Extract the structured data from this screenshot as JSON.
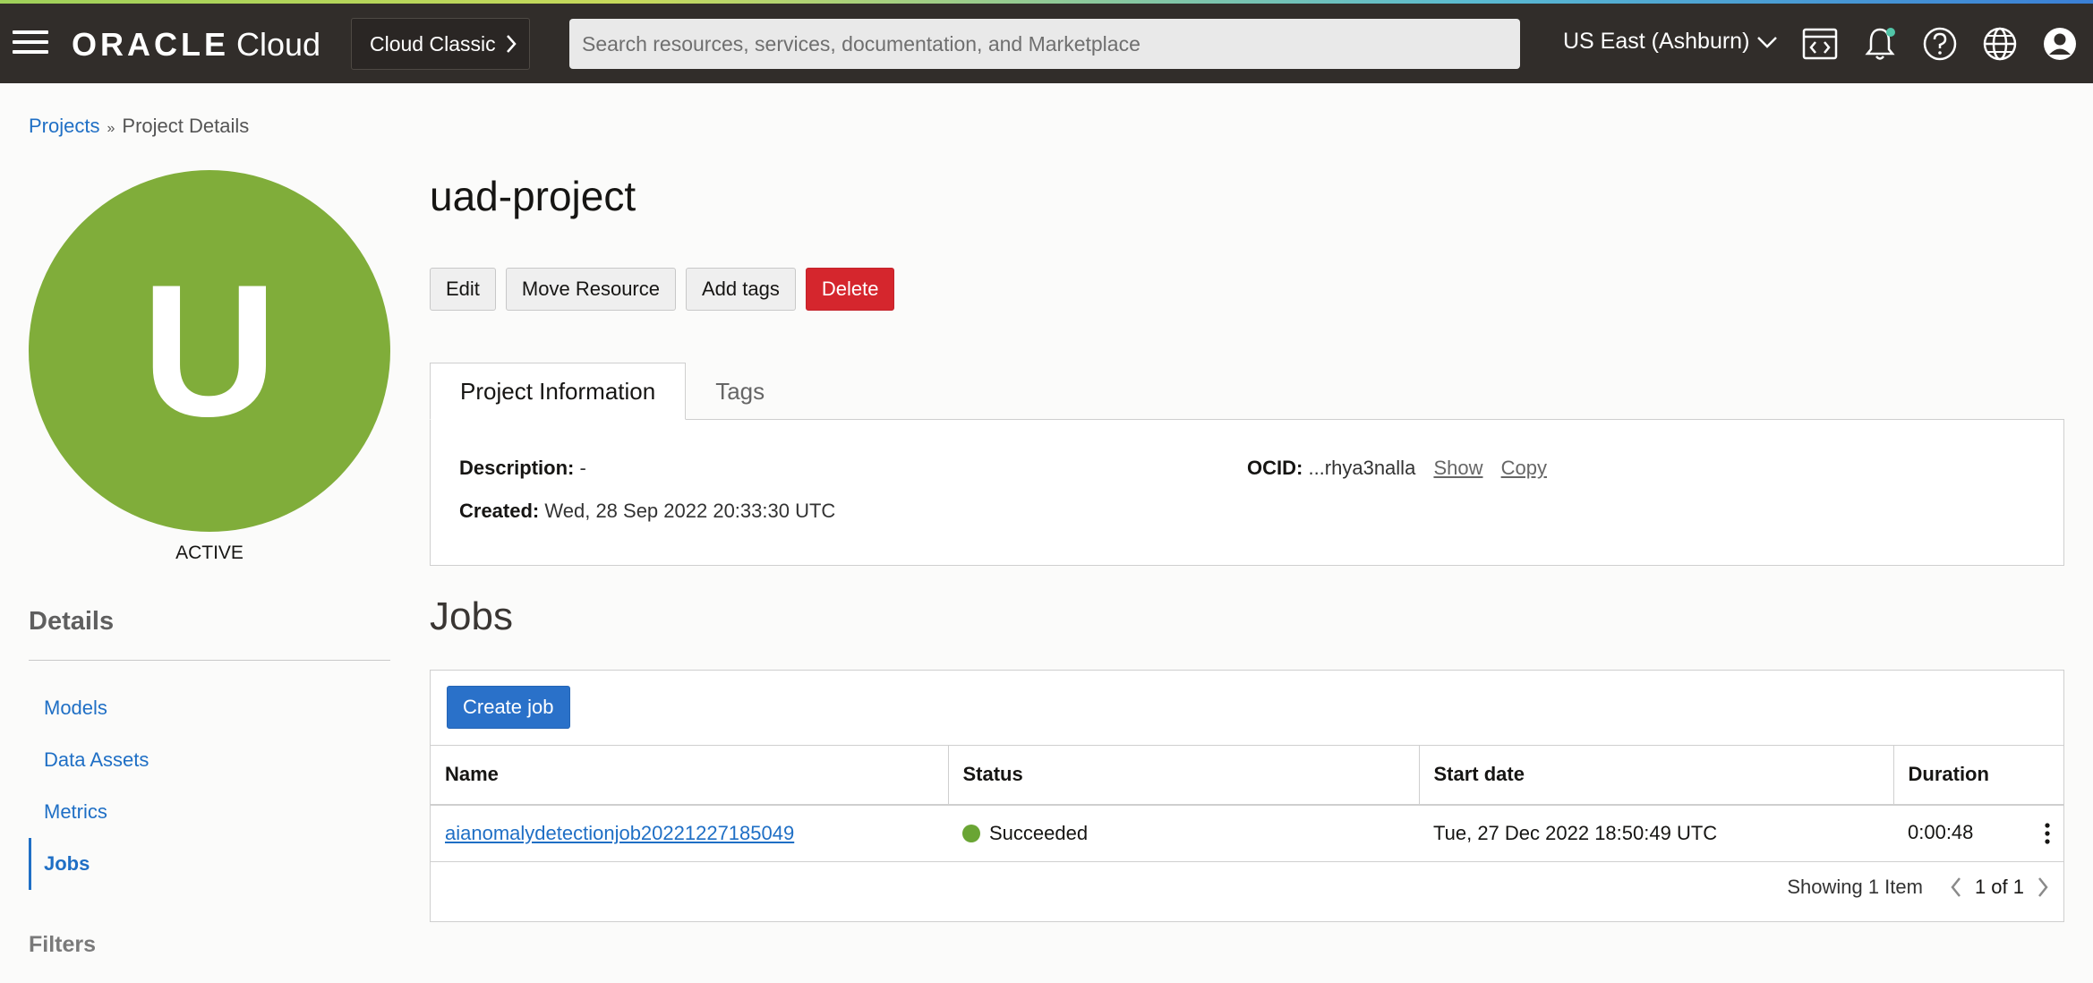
{
  "topbar": {
    "brand": "ORACLE",
    "product": "Cloud",
    "classic_button": "Cloud Classic",
    "search_placeholder": "Search resources, services, documentation, and Marketplace",
    "search_value": "",
    "region": "US East (Ashburn)",
    "accent_color": "#312d2a"
  },
  "breadcrumb": {
    "parent": "Projects",
    "current": "Project Details"
  },
  "project": {
    "initial": "U",
    "avatar_color": "#80ad3a",
    "state": "ACTIVE",
    "name": "uad-project"
  },
  "actions": {
    "edit": "Edit",
    "move": "Move Resource",
    "tags": "Add tags",
    "delete": "Delete"
  },
  "tabs": [
    {
      "label": "Project Information",
      "active": true
    },
    {
      "label": "Tags",
      "active": false
    }
  ],
  "info": {
    "description_label": "Description:",
    "description_value": "-",
    "created_label": "Created:",
    "created_value": "Wed, 28 Sep 2022 20:33:30 UTC",
    "ocid_label": "OCID:",
    "ocid_value": "...rhya3nalla",
    "show_link": "Show",
    "copy_link": "Copy"
  },
  "sidebar": {
    "heading": "Details",
    "items": [
      {
        "label": "Models",
        "active": false
      },
      {
        "label": "Data Assets",
        "active": false
      },
      {
        "label": "Metrics",
        "active": false
      },
      {
        "label": "Jobs",
        "active": true
      }
    ],
    "filters_heading": "Filters"
  },
  "jobs": {
    "title": "Jobs",
    "create_button": "Create job",
    "columns": [
      "Name",
      "Status",
      "Start date",
      "Duration"
    ],
    "rows": [
      {
        "name": "aianomalydetectionjob20221227185049",
        "status": "Succeeded",
        "status_color": "#6aa534",
        "start_date": "Tue, 27 Dec 2022 18:50:49 UTC",
        "duration": "0:00:48"
      }
    ],
    "showing": "Showing 1 Item",
    "page": "1 of 1"
  }
}
